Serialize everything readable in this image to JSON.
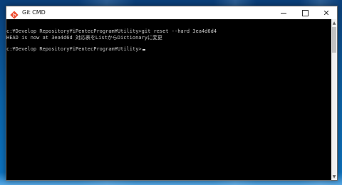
{
  "window": {
    "title": "Git CMD",
    "icon": "git-logo-icon"
  },
  "controls": {
    "minimize_icon": "minimize-icon",
    "maximize_icon": "maximize-icon",
    "close_icon": "close-icon",
    "close_glyph": "✕"
  },
  "console": {
    "lines": [
      "c:¥Develop Repository¥iPentecProgram¥Utility>git reset --hard 3ea4d6d4",
      "HEAD is now at 3ea4d6d 対応表をListからDictionaryに変更",
      "c:¥Develop Repository¥iPentecProgram¥Utility>"
    ]
  },
  "scrollbar": {
    "up_glyph": "▲",
    "down_glyph": "▼"
  },
  "colors": {
    "console_bg": "#000000",
    "console_text": "#c8c8c8",
    "desktop": "#0b63a8",
    "git_orange": "#f05033"
  }
}
